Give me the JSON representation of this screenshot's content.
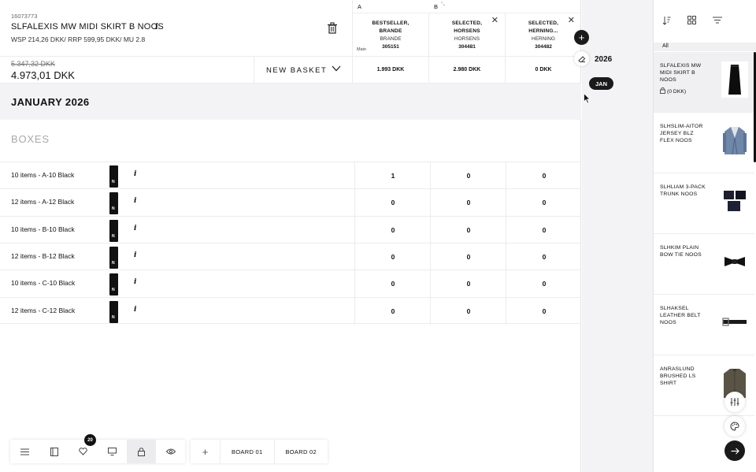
{
  "product": {
    "id": "16073773",
    "name": "SLFALEXIS MW MIDI SKIRT B NOOS",
    "prices": "WSP 214,26 DKK/ RRP 599,95 DKK/ MU 2.8",
    "old_price": "5.347,32 DKK",
    "new_price": "4.973,01 DKK",
    "info_glyph": "i"
  },
  "basket": {
    "label": "NEW BASKET"
  },
  "store_letters": [
    "A",
    "B"
  ],
  "stores": [
    {
      "name_line1": "BESTSELLER,",
      "name_line2": "BRANDE",
      "city": "BRANDE",
      "number": "305151",
      "tag": "Main",
      "total": "1.993 DKK"
    },
    {
      "name_line1": "SELECTED,",
      "name_line2": "HORSENS",
      "city": "HORSENS",
      "number": "304481",
      "total": "2.980 DKK"
    },
    {
      "name_line1": "SELECTED,",
      "name_line2": "HERNING...",
      "city": "HERNING",
      "number": "304482",
      "total": "0 DKK"
    }
  ],
  "month": "JANUARY 2026",
  "boxes_label": "BOXES",
  "rows": [
    {
      "label": "10 items - A-10 Black",
      "values": [
        "1",
        "0",
        "0"
      ]
    },
    {
      "label": "12 items - A-12 Black",
      "values": [
        "0",
        "0",
        "0"
      ]
    },
    {
      "label": "10 items - B-10 Black",
      "values": [
        "0",
        "0",
        "0"
      ]
    },
    {
      "label": "12 items - B-12 Black",
      "values": [
        "0",
        "0",
        "0"
      ]
    },
    {
      "label": "10 items - C-10 Black",
      "values": [
        "0",
        "0",
        "0"
      ]
    },
    {
      "label": "12 items - C-12 Black",
      "values": [
        "0",
        "0",
        "0"
      ]
    }
  ],
  "toolbar": {
    "badge_count": "20",
    "boards": [
      "BOARD 01",
      "BOARD 02"
    ],
    "plus": "+"
  },
  "timeline": {
    "year": "2026",
    "month_pill": "JAN"
  },
  "sidebar": {
    "tab": "All",
    "items": [
      {
        "name": "SLFALEXIS MW MIDI SKIRT B NOOS",
        "basket": "(0 DKK)",
        "icon": "skirt"
      },
      {
        "name": "SLHSLIM-AITOR JERSEY BLZ FLEX NOOS",
        "icon": "blazer"
      },
      {
        "name": "SLHLIAM 3-PACK TRUNK NOOS",
        "icon": "trunks"
      },
      {
        "name": "SLHKIM PLAIN BOW TIE NOOS",
        "icon": "bow-tie"
      },
      {
        "name": "SLHAKSEL LEATHER BELT NOOS",
        "icon": "belt"
      },
      {
        "name": "ANRASLUND BRUSHED LS SHIRT",
        "icon": "shirt"
      }
    ]
  },
  "colors": {
    "accent_dark": "#1a1a1a",
    "band_bg": "#f3f3f5",
    "muted": "#a9a9a9"
  }
}
